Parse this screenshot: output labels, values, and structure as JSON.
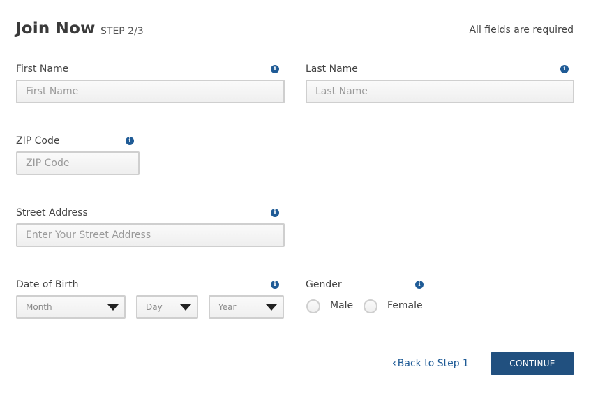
{
  "header": {
    "title": "Join Now",
    "step": "STEP 2/3",
    "required_note": "All fields are required"
  },
  "fields": {
    "first_name": {
      "label": "First Name",
      "placeholder": "First Name",
      "value": ""
    },
    "last_name": {
      "label": "Last Name",
      "placeholder": "Last Name",
      "value": ""
    },
    "zip": {
      "label": "ZIP Code",
      "placeholder": "ZIP Code",
      "value": ""
    },
    "street": {
      "label": "Street Address",
      "placeholder": "Enter Your Street Address",
      "value": ""
    },
    "dob": {
      "label": "Date of Birth",
      "month": "Month",
      "day": "Day",
      "year": "Year"
    },
    "gender": {
      "label": "Gender",
      "options": [
        "Male",
        "Female"
      ]
    }
  },
  "icons": {
    "info_glyph": "i"
  },
  "actions": {
    "back_chevron": "‹",
    "back_label": "Back to Step 1",
    "continue_label": "CONTINUE"
  },
  "colors": {
    "accent": "#1f5b96",
    "button": "#21507f",
    "border": "#cfcfcf",
    "placeholder": "#9a9a9a"
  }
}
